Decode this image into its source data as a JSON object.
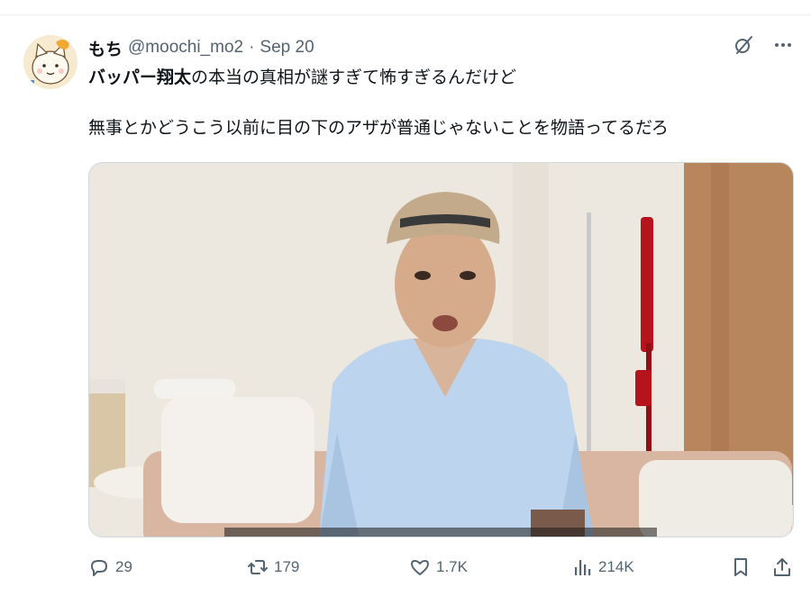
{
  "tweet": {
    "display_name": "もち",
    "handle": "@moochi_mo2",
    "separator": "·",
    "date": "Sep 20",
    "text_bold": "バッパー翔太",
    "text_line1_rest": "の本当の真相が謎すぎて怖すぎるんだけど",
    "text_line2": "無事とかどうこう以前に目の下のアザが普通じゃないことを物語ってるだろ"
  },
  "metrics": {
    "replies": "29",
    "retweets": "179",
    "likes": "1.7K",
    "views": "214K"
  },
  "icons": {
    "avatar": "cartoon-cat-avatar",
    "header_left": "grok-icon",
    "header_right": "more-icon",
    "reply": "reply-icon",
    "retweet": "retweet-icon",
    "like": "heart-icon",
    "views": "views-icon",
    "bookmark": "bookmark-icon",
    "share": "share-icon"
  },
  "colors": {
    "text": "#0f1419",
    "secondary": "#536471",
    "divider": "#eff3f4"
  }
}
